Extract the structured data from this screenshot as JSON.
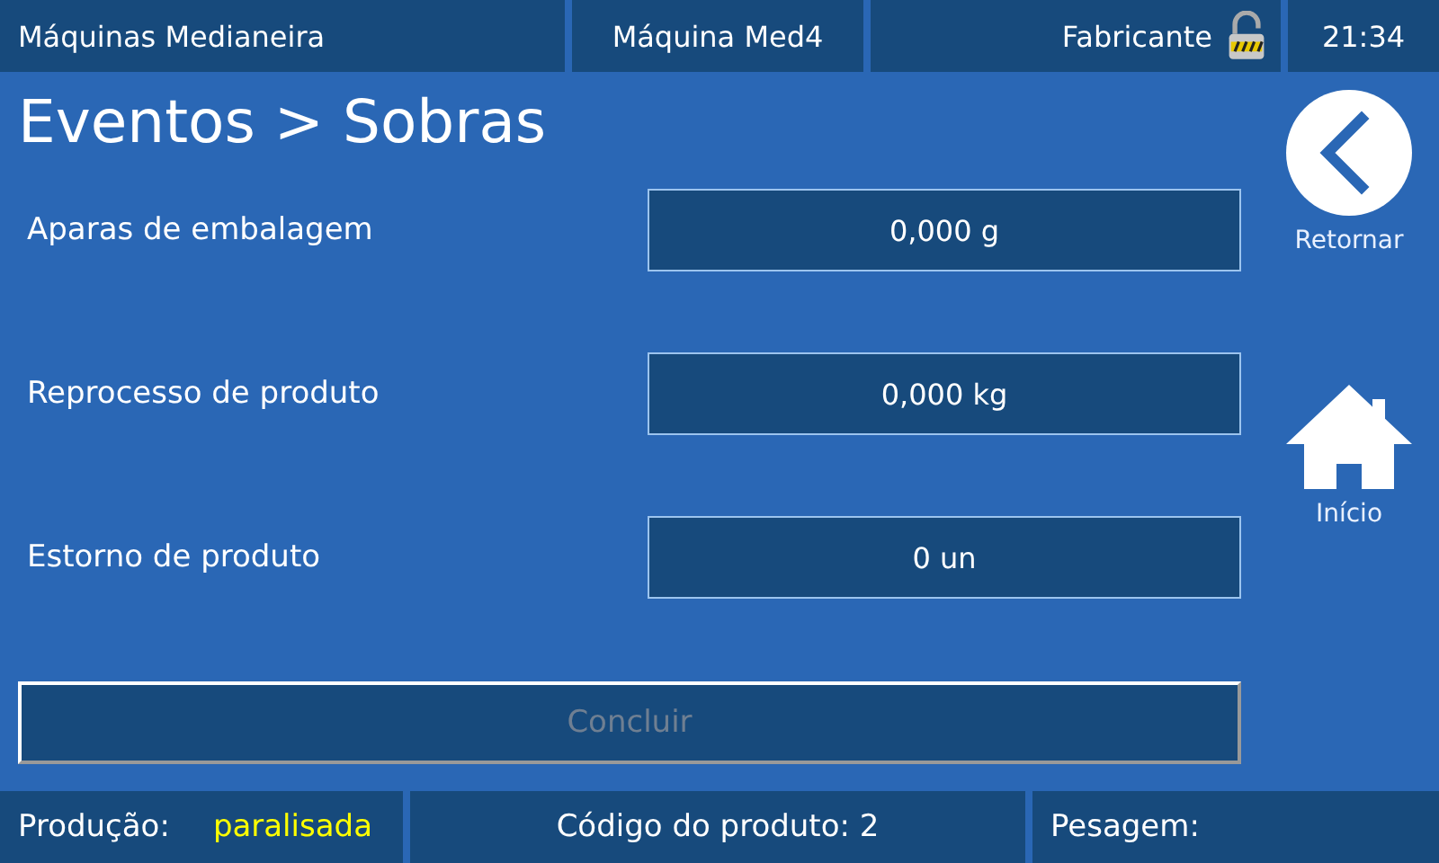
{
  "header": {
    "app_name": "Máquinas Medianeira",
    "machine": "Máquina Med4",
    "user": "Fabricante",
    "locked": false,
    "time": "21:34"
  },
  "title": "Eventos > Sobras",
  "fields": [
    {
      "label": "Aparas de embalagem",
      "value": "0,000 g"
    },
    {
      "label": "Reprocesso de produto",
      "value": "0,000 kg"
    },
    {
      "label": "Estorno de produto",
      "value": "0 un"
    }
  ],
  "conclude_button": {
    "label": "Concluir",
    "disabled": true
  },
  "nav": [
    {
      "kind": "back",
      "label": "Retornar"
    },
    {
      "kind": "home",
      "label": "Início"
    }
  ],
  "status_bar": {
    "production_label": "Produção:",
    "production_value": "paralisada",
    "product_code": "Código do produto: 2",
    "weighing": "Pesagem:"
  }
}
